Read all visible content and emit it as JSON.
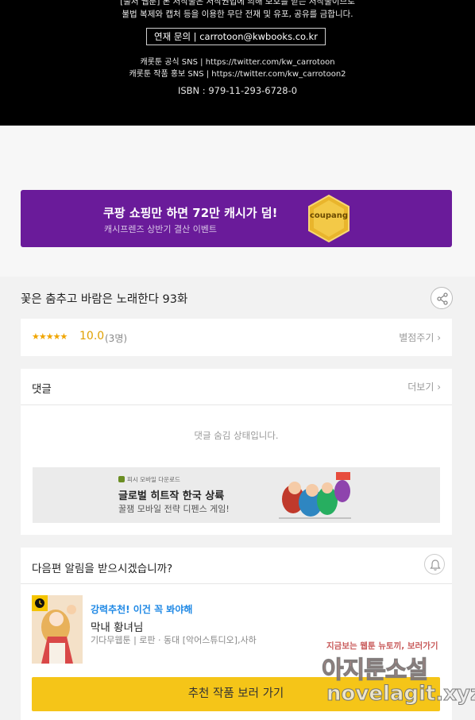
{
  "footer": {
    "copyright_line1": "[출처 웹툰] 본 저작물은 저작권법에 의해 보호를 받는 저작물이므로",
    "copyright_line2": "불법 복제와 캡처 등을 이용한 무단 전재 및 유포, 공유를 금합니다.",
    "contact": "연재 문의 | carrotoon@kwbooks.co.kr",
    "sns_official": "캐롯툰 공식 SNS | https://twitter.com/kw_carrotoon",
    "sns_promo": "캐롯툰 작품 홍보 SNS | https://twitter.com/kw_carrotoon2",
    "isbn": "ISBN : 979-11-293-6728-0"
  },
  "banner": {
    "title": "쿠팡 쇼핑만 하면 72만 캐시가 덤!",
    "subtitle": "캐시프렌즈 상반기 결산 이벤트",
    "coin_label": "coupang",
    "accent_color": "#6a1b9a"
  },
  "episode": {
    "title": "꽃은 춤추고 바람은 노래한다 93화",
    "share_icon": "share-icon"
  },
  "rating": {
    "stars": "★★★★★",
    "score": "10.0",
    "count": "(3명)",
    "rate_link": "별점주기 ›"
  },
  "comments": {
    "header": "댓글",
    "more": "더보기 ›",
    "hidden_notice": "댓글 숨김 상태입니다."
  },
  "ad": {
    "small": "피시 모바일 다운로드",
    "title": "글로벌 히트작 한국 상륙",
    "subtitle": "꿀잼 모바일 전략 디펜스 게임!"
  },
  "notification": {
    "question": "다음편 알림을 받으시겠습니까?",
    "bell_icon": "bell-icon"
  },
  "recommendation": {
    "tag": "강력추천! 이건 꼭 봐야해",
    "name": "막내 황녀님",
    "meta": "기다무웹툰 | 로판 · 동대 [악어스튜디오],사하",
    "button": "추천 작품 보러 가기",
    "button_color": "#f5c518"
  },
  "watermark": {
    "line1": "지금보는 웹툰 뉴토끼, 보러가기",
    "line2": "아지툰소설",
    "line3": "novelagit.xyz"
  }
}
